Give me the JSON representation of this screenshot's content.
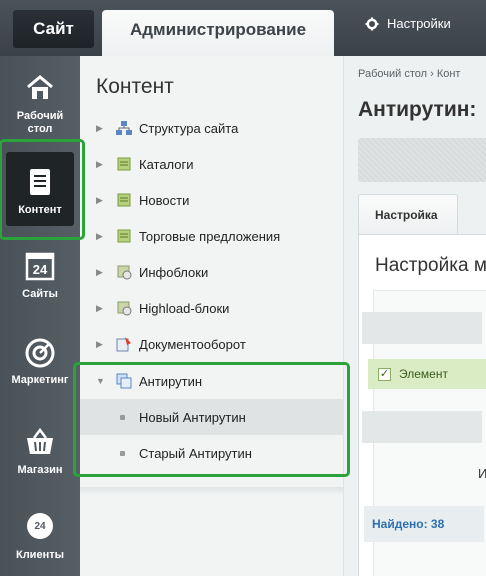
{
  "topbar": {
    "site_tab": "Сайт",
    "admin_tab": "Администрирование",
    "settings_label": "Настройки"
  },
  "left_menu": {
    "items": [
      {
        "label": "Рабочий стол",
        "icon": "home-icon"
      },
      {
        "label": "Контент",
        "icon": "document-icon"
      },
      {
        "label": "Сайты",
        "icon": "calendar-24-icon",
        "badge": "24"
      },
      {
        "label": "Маркетинг",
        "icon": "target-icon"
      },
      {
        "label": "Магазин",
        "icon": "basket-icon"
      },
      {
        "label": "Клиенты",
        "icon": "clients-24-icon",
        "badge": "24"
      }
    ]
  },
  "tree": {
    "title": "Контент",
    "items": [
      {
        "label": "Структура сайта",
        "icon": "structure-icon"
      },
      {
        "label": "Каталоги",
        "icon": "catalog-icon"
      },
      {
        "label": "Новости",
        "icon": "news-icon"
      },
      {
        "label": "Торговые предложения",
        "icon": "offers-icon"
      },
      {
        "label": "Инфоблоки",
        "icon": "iblock-icon"
      },
      {
        "label": "Highload-блоки",
        "icon": "highload-icon"
      },
      {
        "label": "Документооборот",
        "icon": "workflow-icon"
      },
      {
        "label": "Антирутин",
        "icon": "antirutin-icon",
        "expanded": true
      }
    ],
    "subitems": [
      {
        "label": "Новый Антирутин",
        "active": true
      },
      {
        "label": "Старый Антирутин",
        "active": false
      }
    ]
  },
  "main": {
    "breadcrumb": "Рабочий стол  ›  Конт",
    "page_title": "Антирутин:",
    "tab_label": "Настройка",
    "content_title": "Настройка м",
    "element_label": "Элемент",
    "letter": "И",
    "found_label": "Найдено: 38"
  },
  "colors": {
    "highlight_green": "#2aa33a",
    "link_blue": "#2d6eaf"
  }
}
